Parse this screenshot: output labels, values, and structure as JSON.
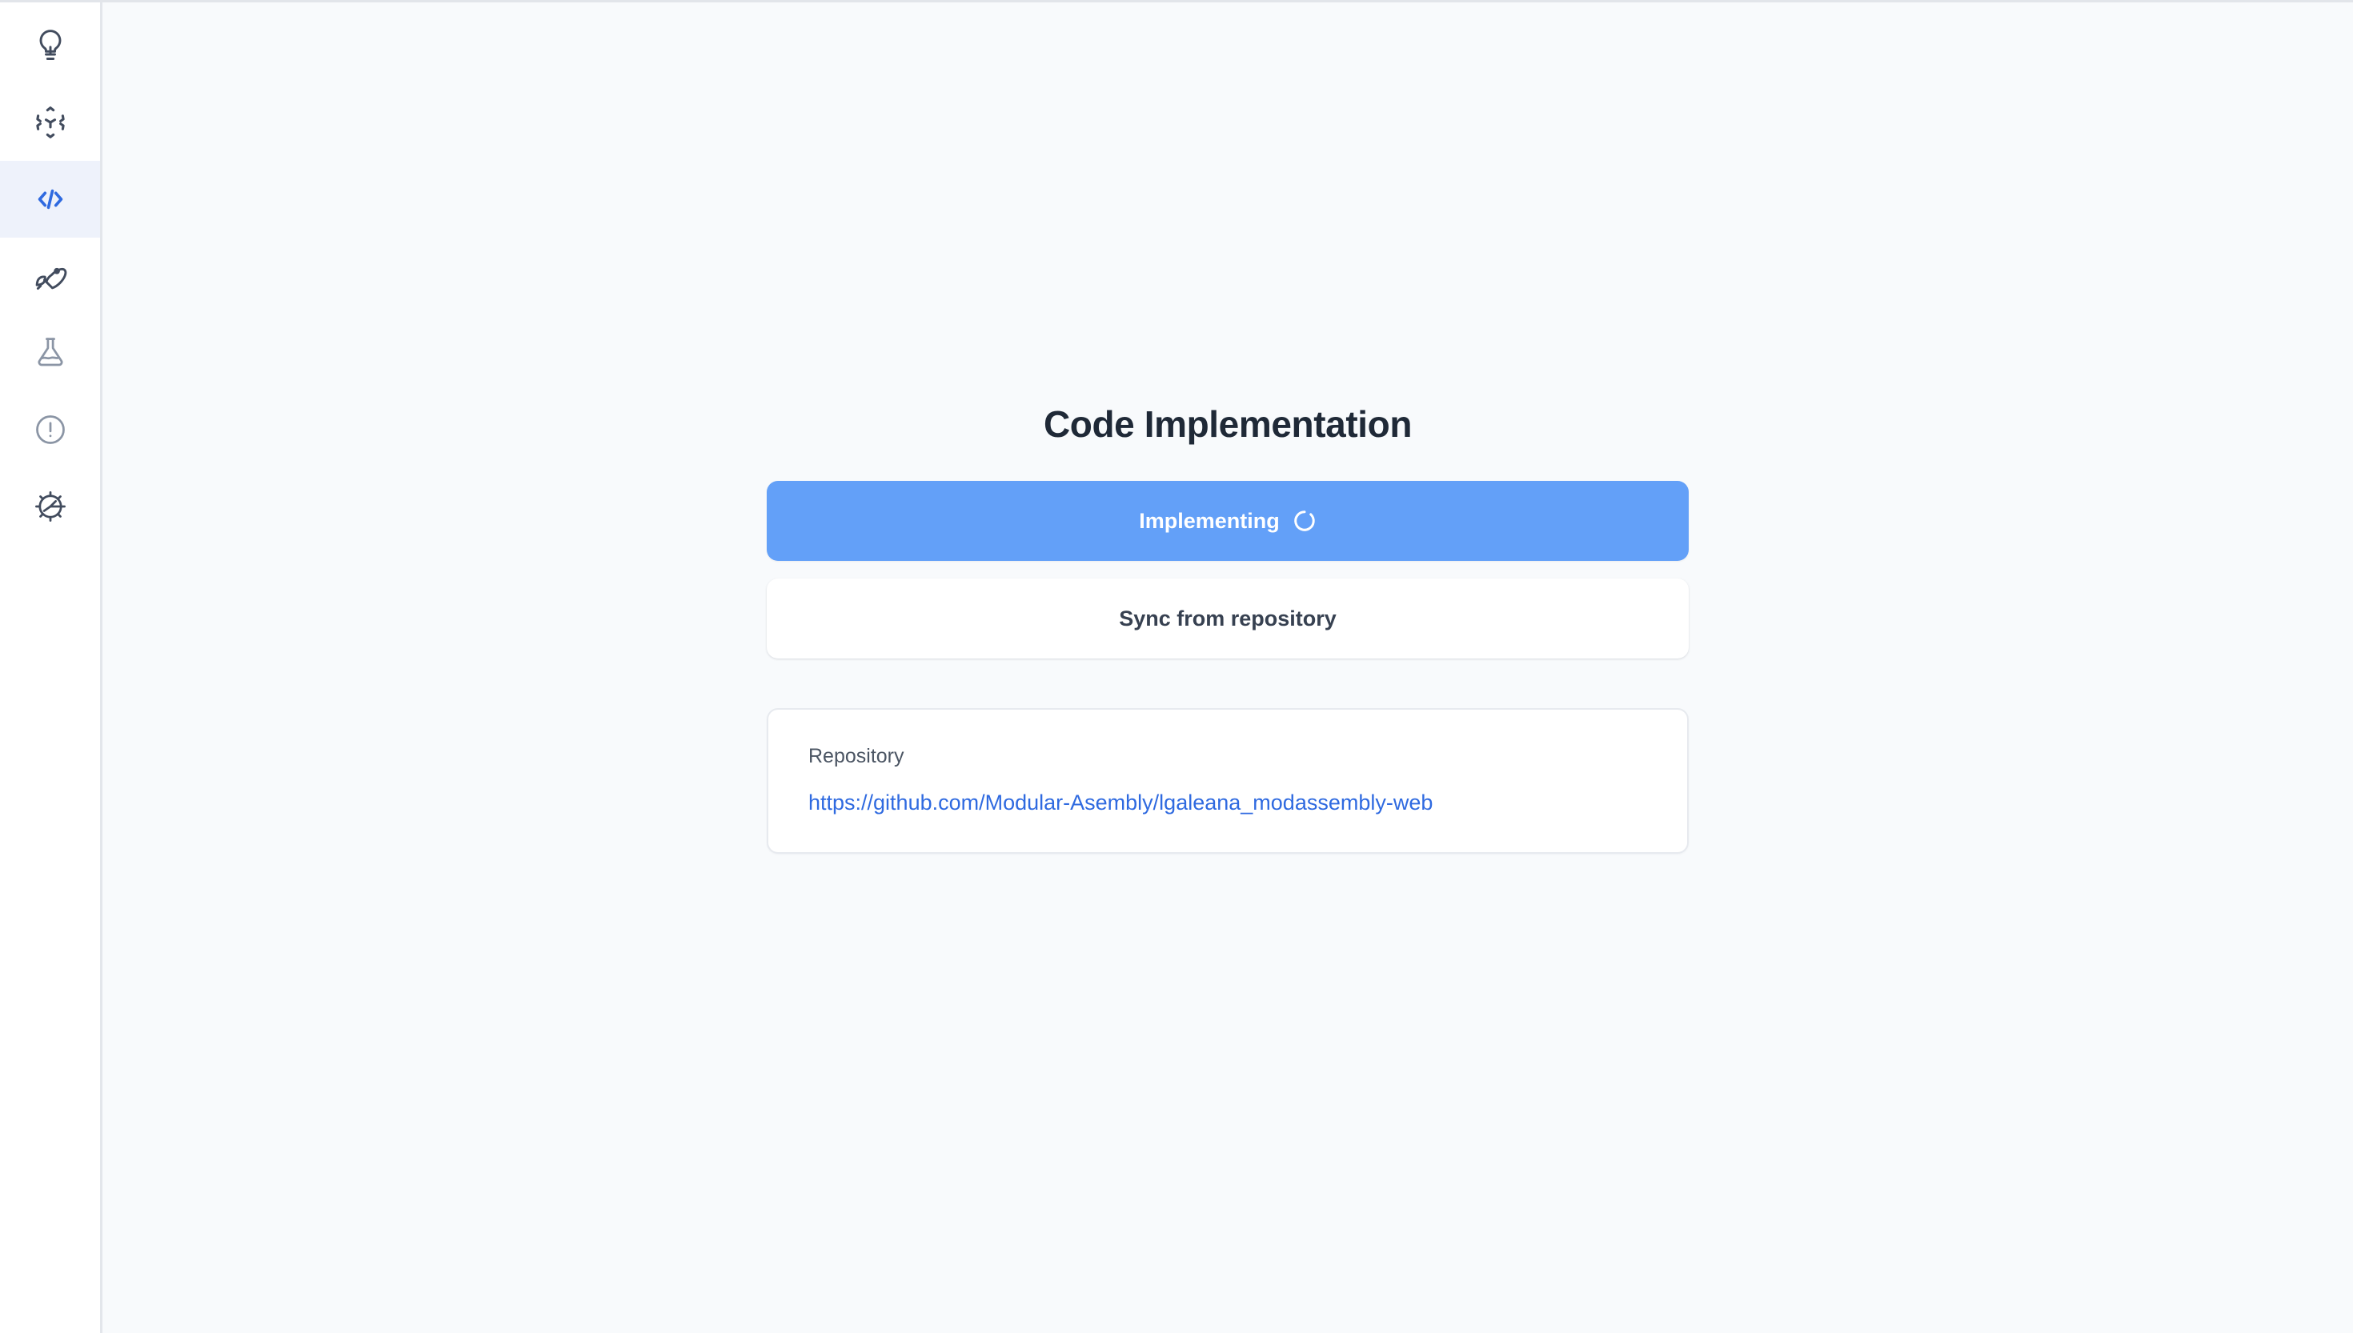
{
  "sidebar": {
    "items": [
      {
        "icon": "lightbulb-icon",
        "label": "Ideas",
        "active": false
      },
      {
        "icon": "cube-scan-icon",
        "label": "Architecture",
        "active": false
      },
      {
        "icon": "code-brackets-icon",
        "label": "Code Implementation",
        "active": true
      },
      {
        "icon": "rocket-icon",
        "label": "Deploy",
        "active": false
      },
      {
        "icon": "flask-icon",
        "label": "Experiments",
        "active": false
      },
      {
        "icon": "alert-circle-icon",
        "label": "Issues",
        "active": false
      },
      {
        "icon": "gear-icon",
        "label": "Settings",
        "active": false
      }
    ],
    "active_color": "#2f6ae0",
    "active_background": "#eef2fb"
  },
  "main": {
    "title": "Code Implementation",
    "primary_button": {
      "label": "Implementing",
      "icon": "spinner-icon",
      "state": "loading",
      "background": "#63a0f8",
      "text_color": "#ffffff"
    },
    "secondary_button": {
      "label": "Sync from repository",
      "background": "#ffffff",
      "text_color": "#374151"
    },
    "repository_card": {
      "label": "Repository",
      "url": "https://github.com/Modular-Asembly/lgaleana_modassembly-web",
      "link_color": "#2f6ae0"
    }
  }
}
